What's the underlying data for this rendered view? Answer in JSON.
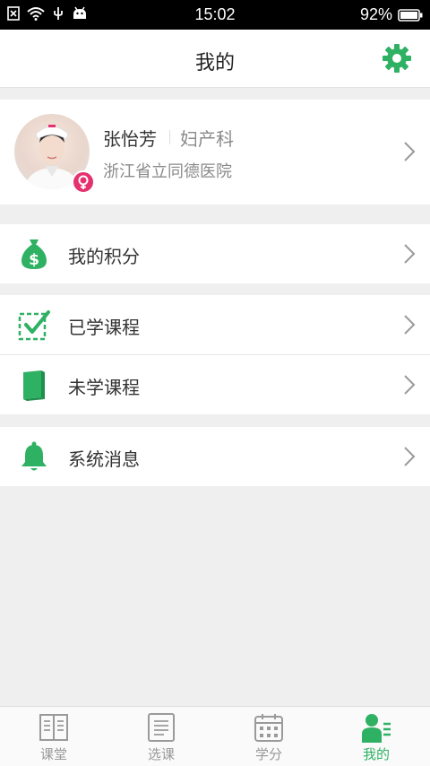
{
  "status_bar": {
    "time": "15:02",
    "battery": "92%"
  },
  "header": {
    "title": "我的"
  },
  "profile": {
    "name": "张怡芳",
    "department": "妇产科",
    "hospital": "浙江省立同德医院"
  },
  "menu": [
    {
      "label": "我的积分",
      "icon": "money-bag-icon"
    },
    {
      "label": "已学课程",
      "icon": "checked-box-icon"
    },
    {
      "label": "未学课程",
      "icon": "book-icon"
    },
    {
      "label": "系统消息",
      "icon": "bell-icon"
    }
  ],
  "tabs": [
    {
      "label": "课堂",
      "icon": "open-book-icon",
      "active": false
    },
    {
      "label": "选课",
      "icon": "document-icon",
      "active": false
    },
    {
      "label": "学分",
      "icon": "calendar-icon",
      "active": false
    },
    {
      "label": "我的",
      "icon": "person-list-icon",
      "active": true
    }
  ],
  "colors": {
    "accent": "#2fb163",
    "badge": "#e5316e",
    "background": "#efefef"
  }
}
